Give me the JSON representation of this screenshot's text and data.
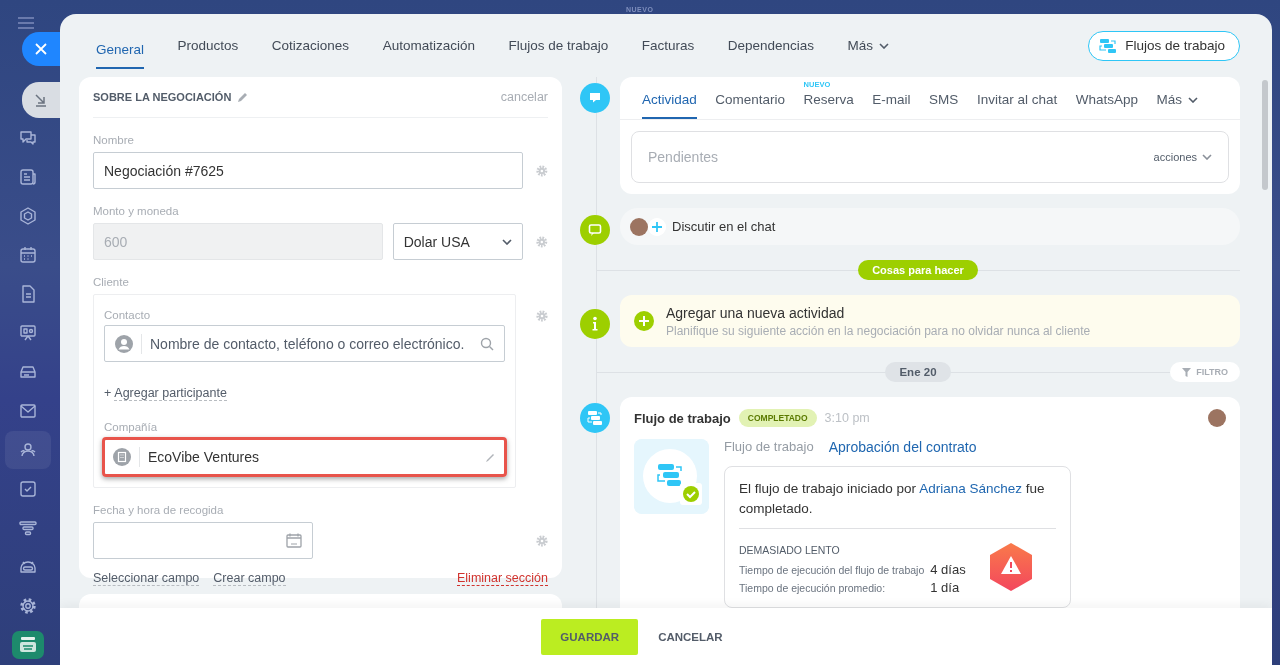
{
  "background_label": "NUEVO",
  "rail": {
    "items": [
      {
        "kind": "chat",
        "selected": false
      },
      {
        "kind": "news",
        "selected": false
      },
      {
        "kind": "hexagon",
        "selected": false
      },
      {
        "kind": "calendar",
        "selected": false
      },
      {
        "kind": "document",
        "selected": false
      },
      {
        "kind": "presentation",
        "selected": false
      },
      {
        "kind": "drive",
        "selected": false
      },
      {
        "kind": "mail",
        "selected": false
      },
      {
        "kind": "contacts",
        "selected": true
      },
      {
        "kind": "tasks",
        "selected": false
      },
      {
        "kind": "funnel",
        "selected": false
      },
      {
        "kind": "robot",
        "selected": false
      },
      {
        "kind": "settings",
        "selected": false
      },
      {
        "kind": "app",
        "selected": false
      }
    ]
  },
  "tabs": [
    {
      "label": "General",
      "kind": "tab",
      "selected": true
    },
    {
      "label": "Productos",
      "kind": "tab",
      "selected": false
    },
    {
      "label": "Cotizaciones",
      "kind": "tab",
      "selected": false
    },
    {
      "label": "Automatización",
      "kind": "tab",
      "selected": false
    },
    {
      "label": "Flujos de trabajo",
      "kind": "tab",
      "selected": false
    },
    {
      "label": "Facturas",
      "kind": "tab",
      "selected": false
    },
    {
      "label": "Dependencias",
      "kind": "tab",
      "selected": false
    },
    {
      "label": "Más",
      "kind": "more",
      "selected": false
    }
  ],
  "header_button": {
    "label": "Flujos de trabajo"
  },
  "section": {
    "title": "SOBRE LA NEGOCIACIÓN",
    "cancel_link": "cancelar",
    "fields": [
      {
        "kind": "text",
        "label": "Nombre",
        "value": "Negociación #7625"
      },
      {
        "kind": "money",
        "label": "Monto y moneda",
        "value": "600",
        "disabled": true,
        "currency": "Dolar USA"
      },
      {
        "kind": "client",
        "label": "Cliente",
        "contact_label": "Contacto",
        "contact_placeholder": "Nombre de contacto, teléfono o correo electrónico.",
        "add_sign": "+",
        "add_participant": "Agregar participante",
        "company_label": "Compañía",
        "company_value": "EcoVibe Ventures",
        "highlighted": true
      },
      {
        "kind": "date",
        "label": "Fecha y hora de recogida"
      }
    ],
    "links": [
      {
        "label": "Seleccionar campo",
        "kind": "normal"
      },
      {
        "label": "Crear campo",
        "kind": "normal"
      },
      {
        "label": "Eliminar sección",
        "kind": "danger"
      }
    ]
  },
  "timeline": {
    "composer": {
      "tabs": [
        {
          "label": "Actividad",
          "selected": true
        },
        {
          "label": "Comentario",
          "selected": false
        },
        {
          "label": "Reserva",
          "selected": false,
          "badge": "NUEVO"
        },
        {
          "label": "E-mail",
          "selected": false
        },
        {
          "label": "SMS",
          "selected": false
        },
        {
          "label": "Invitar al chat",
          "selected": false
        },
        {
          "label": "WhatsApp",
          "selected": false
        },
        {
          "label": "Más",
          "selected": false,
          "kind": "more"
        }
      ],
      "placeholder": "Pendientes",
      "actions": "acciones"
    },
    "chat": {
      "label": "Discutir en el chat"
    },
    "todo_label": "Cosas para hacer",
    "suggestion": {
      "title": "Agregar una nueva actividad",
      "subtitle": "Planifique su siguiente acción en la negociación para no olvidar nunca al cliente"
    },
    "date": "Ene 20",
    "filter": "FILTRO",
    "events": [
      {
        "kind": "workflow",
        "title": "Flujo de trabajo",
        "status": "COMPLETADO",
        "time": "3:10 pm",
        "field_label": "Flujo de trabajo",
        "field_link": "Aprobación del contrato",
        "message_before": "El flujo de trabajo iniciado por",
        "message_link": "Adriana Sánchez",
        "message_after": "fue completado.",
        "warning": "DEMASIADO LENTO",
        "stats": [
          {
            "label": "Tiempo de ejecución del flujo de trabajo",
            "value": "4 días"
          },
          {
            "label": "Tiempo de ejecución promedio:",
            "value": "1 día"
          }
        ]
      }
    ]
  },
  "footer": {
    "buttons": [
      {
        "label": "GUARDAR",
        "kind": "primary"
      },
      {
        "label": "CANCELAR",
        "kind": "secondary"
      }
    ]
  }
}
